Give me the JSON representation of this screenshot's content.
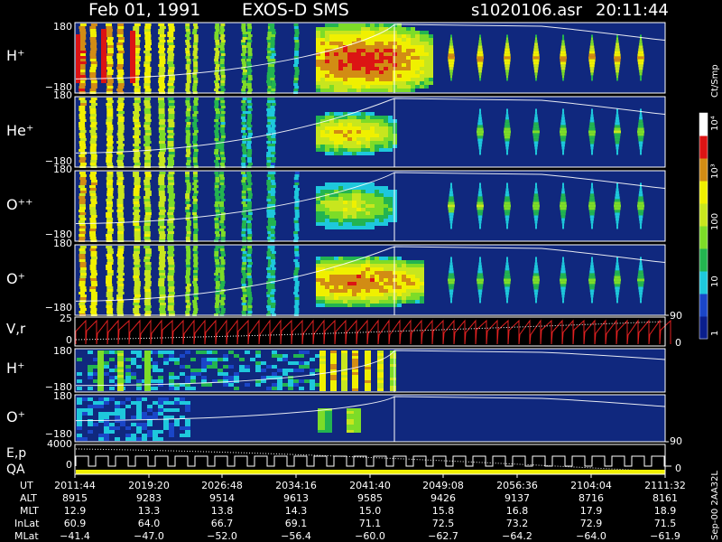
{
  "header": {
    "date": "Feb 01, 1991",
    "instrument": "EXOS-D SMS",
    "file": "s1020106.asr",
    "time": "20:11:44"
  },
  "colorbar": {
    "unit": "Ct/Smp",
    "labels": [
      "1",
      "10",
      "100",
      "10³",
      "10⁴"
    ],
    "colors": [
      "#0a1e8c",
      "#1a46c8",
      "#1ec8dc",
      "#23b450",
      "#7ddc28",
      "#c8e61e",
      "#f0f000",
      "#d28c14",
      "#dc1414",
      "#ffffff"
    ]
  },
  "panels": [
    {
      "id": "h-plus",
      "label": "H⁺",
      "top": "180",
      "bottom": "−180"
    },
    {
      "id": "he-plus",
      "label": "He⁺",
      "top": "180",
      "bottom": "−180"
    },
    {
      "id": "o-plus-plus",
      "label": "O⁺⁺",
      "top": "180",
      "bottom": "−180"
    },
    {
      "id": "o-plus",
      "label": "O⁺",
      "top": "180",
      "bottom": "−180"
    },
    {
      "id": "vr",
      "label": "V,r",
      "top": "25",
      "bottom": "0"
    },
    {
      "id": "h-plus-2",
      "label": "H⁺",
      "top": "180",
      "bottom": "−180"
    },
    {
      "id": "o-plus-2",
      "label": "O⁺",
      "top": "180",
      "bottom": "−180"
    },
    {
      "id": "ep-qa",
      "label": "E,p",
      "label2": "QA",
      "top": "4000",
      "bottom": "0"
    }
  ],
  "right_axis": {
    "o_plus_marker": "90",
    "vr_top": "90",
    "vr_bottom": "0",
    "o2_marker": "90",
    "ep_zero": "0"
  },
  "side_note": "Sep-00 2AA32L",
  "table": {
    "row_labels": [
      "UT",
      "ALT",
      "MLT",
      "InLat",
      "MLat"
    ],
    "columns": [
      {
        "UT": "2011:44",
        "ALT": "8915",
        "MLT": "12.9",
        "InLat": "60.9",
        "MLat": "−41.4"
      },
      {
        "UT": "2019:20",
        "ALT": "9283",
        "MLT": "13.3",
        "InLat": "64.0",
        "MLat": "−47.0"
      },
      {
        "UT": "2026:48",
        "ALT": "9514",
        "MLT": "13.8",
        "InLat": "66.7",
        "MLat": "−52.0"
      },
      {
        "UT": "2034:16",
        "ALT": "9613",
        "MLT": "14.3",
        "InLat": "69.1",
        "MLat": "−56.4"
      },
      {
        "UT": "2041:40",
        "ALT": "9585",
        "MLT": "15.0",
        "InLat": "71.1",
        "MLat": "−60.0"
      },
      {
        "UT": "2049:08",
        "ALT": "9426",
        "MLT": "15.8",
        "InLat": "72.5",
        "MLat": "−62.7"
      },
      {
        "UT": "2056:36",
        "ALT": "9137",
        "MLT": "16.8",
        "InLat": "73.2",
        "MLat": "−64.2"
      },
      {
        "UT": "2104:04",
        "ALT": "8716",
        "MLT": "17.9",
        "InLat": "72.9",
        "MLat": "−64.0"
      },
      {
        "UT": "2111:32",
        "ALT": "8161",
        "MLT": "18.9",
        "InLat": "71.5",
        "MLat": "−61.9"
      }
    ]
  },
  "chart_data": {
    "type": "heatmap",
    "x_ticks": [
      "2011:44",
      "2019:20",
      "2026:48",
      "2034:16",
      "2041:40",
      "2049:08",
      "2056:36",
      "2104:04",
      "2111:32"
    ],
    "ylim_angle": [
      -180,
      180
    ],
    "colorbar_range": [
      1,
      10000
    ],
    "colorbar_scale": "log"
  }
}
